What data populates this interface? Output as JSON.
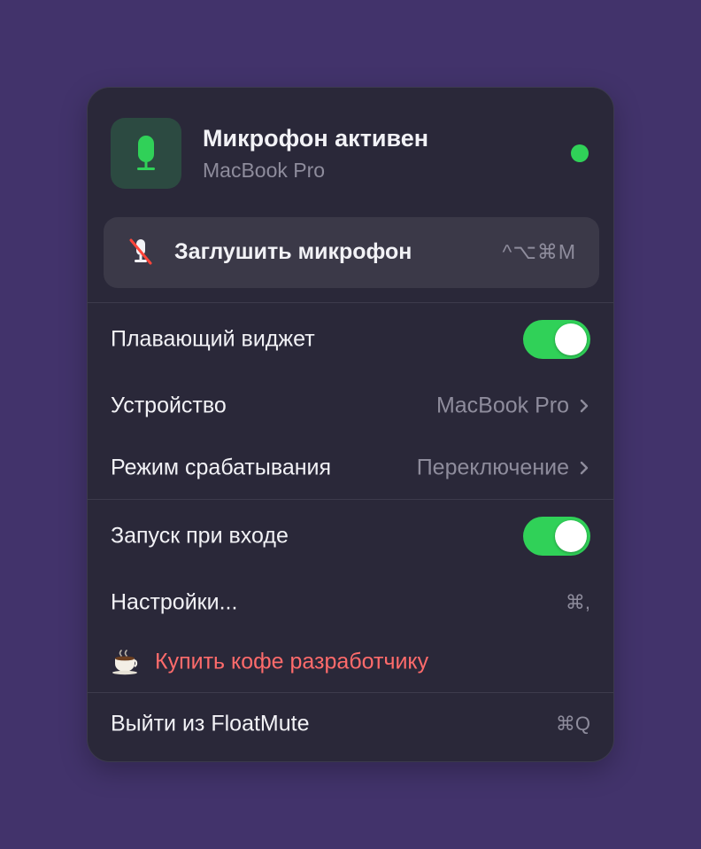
{
  "header": {
    "title": "Микрофон активен",
    "subtitle": "MacBook Pro",
    "icon": "microphone-icon",
    "status_color": "#30d158"
  },
  "mute_button": {
    "label": "Заглушить микрофон",
    "shortcut": "^⌥⌘M",
    "icon": "microphone-slash-icon"
  },
  "items": {
    "floating_widget": {
      "label": "Плавающий виджет",
      "enabled": true
    },
    "device": {
      "label": "Устройство",
      "value": "MacBook Pro"
    },
    "trigger_mode": {
      "label": "Режим срабатывания",
      "value": "Переключение"
    },
    "launch_at_login": {
      "label": "Запуск при входе",
      "enabled": true
    },
    "settings": {
      "label": "Настройки...",
      "shortcut": "⌘,"
    },
    "coffee": {
      "label": "Купить кофе разработчику",
      "icon": "coffee-cup-icon",
      "color": "#ff6b6b"
    },
    "quit": {
      "label": "Выйти из FloatMute",
      "shortcut": "⌘Q"
    }
  },
  "colors": {
    "background": "#42336b",
    "panel": "#2a2839",
    "accent": "#30d158"
  }
}
